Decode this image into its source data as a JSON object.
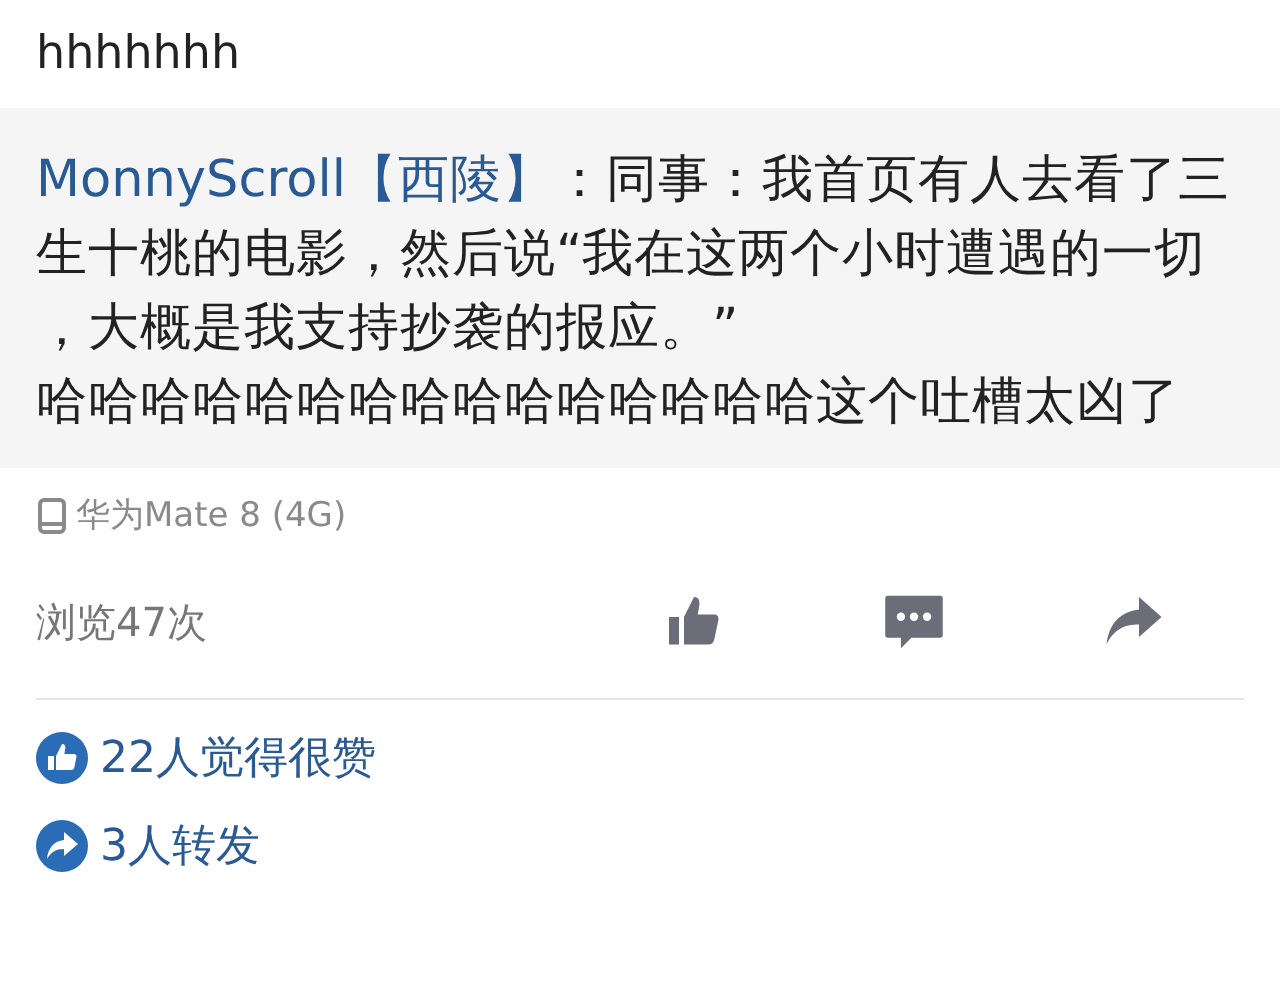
{
  "title": "hhhhhhh",
  "quote": {
    "author": "MonnyScroll",
    "tag": "【西陵】",
    "lines": [
      "：同事：我首页有人去看了三",
      "生十桃的电影，然后说“我在这两个小时遭遇的一切",
      "，大概是我支持抄袭的报应。”",
      "哈哈哈哈哈哈哈哈哈哈哈哈哈哈哈这个吐槽太凶了"
    ]
  },
  "device": "华为Mate 8 (4G)",
  "views": "浏览47次",
  "actions": [
    {
      "kind": "like"
    },
    {
      "kind": "comment"
    },
    {
      "kind": "share"
    }
  ],
  "stats": [
    {
      "kind": "like",
      "text": "22人觉得很赞"
    },
    {
      "kind": "share",
      "text": "3人转发"
    }
  ]
}
